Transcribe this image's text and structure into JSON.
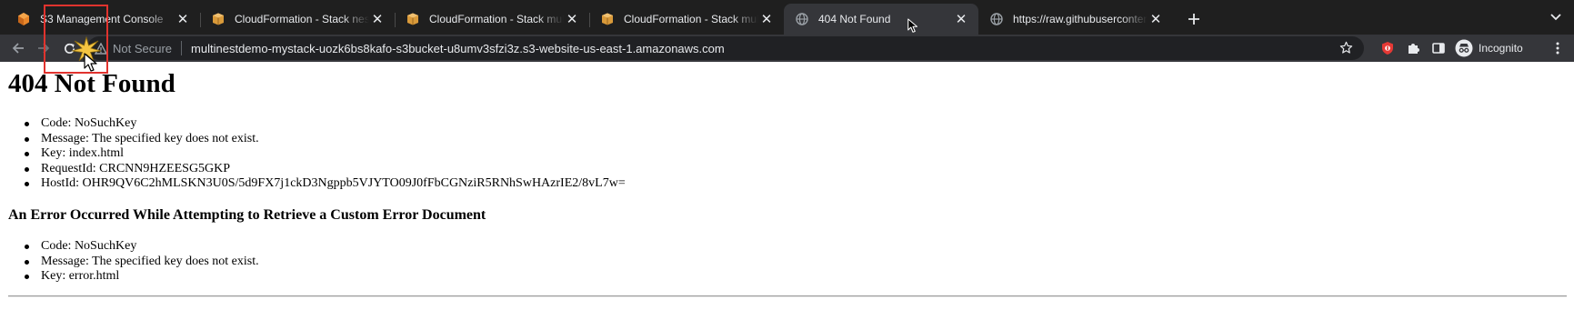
{
  "tabs": [
    {
      "title": "S3 Management Console",
      "favicon": "aws-s3-icon",
      "active": false
    },
    {
      "title": "CloudFormation - Stack nested",
      "favicon": "cloudformation-box-icon",
      "active": false
    },
    {
      "title": "CloudFormation - Stack multinest",
      "favicon": "cloudformation-box-icon",
      "active": false
    },
    {
      "title": "CloudFormation - Stack multinest",
      "favicon": "cloudformation-box-icon",
      "active": false
    },
    {
      "title": "404 Not Found",
      "favicon": "globe-icon",
      "active": true
    },
    {
      "title": "https://raw.githubusercontent.com",
      "favicon": "globe-icon",
      "active": false
    }
  ],
  "toolbar": {
    "security_label": "Not Secure",
    "url": "multinestdemo-mystack-uozk6bs8kafo-s3bucket-u8umv3sfzi3z.s3-website-us-east-1.amazonaws.com",
    "profile_label": "Incognito"
  },
  "page": {
    "heading": "404 Not Found",
    "error_items": [
      "Code: NoSuchKey",
      "Message: The specified key does not exist.",
      "Key: index.html",
      "RequestId: CRCNN9HZEESG5GKP",
      "HostId: OHR9QV6C2hMLSKN3U0S/5d9FX7j1ckD3Ngppb5VJYTO09J0fFbCGNziR5RNhSwHAzrIE2/8vL7w="
    ],
    "subheading": "An Error Occurred While Attempting to Retrieve a Custom Error Document",
    "custom_error_items": [
      "Code: NoSuchKey",
      "Message: The specified key does not exist.",
      "Key: error.html"
    ]
  },
  "colors": {
    "tab_bar_bg": "#1f1f1f",
    "active_tab_bg": "#35363a",
    "omnibox_bg": "#202124",
    "aws_orange": "#e8862a",
    "click_highlight": "#e0332e",
    "extension_red": "#e53935"
  }
}
